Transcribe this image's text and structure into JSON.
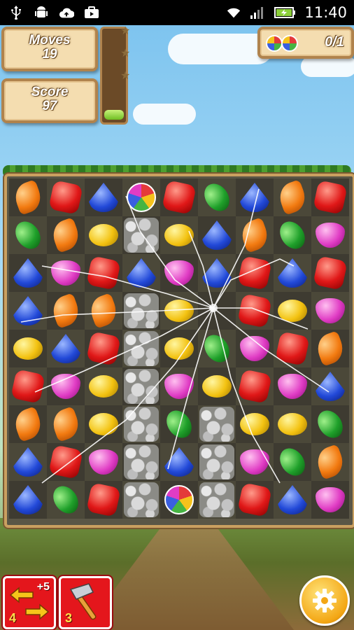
{
  "status_bar": {
    "time": "11:40",
    "left_icons": [
      "usb-icon",
      "android-debug-icon",
      "cloud-upload-icon",
      "briefcase-icon"
    ],
    "right_icons": [
      "wifi-icon",
      "signal-icon",
      "battery-icon"
    ]
  },
  "hud": {
    "moves_label": "Moves",
    "moves_value": "19",
    "score_label": "Score",
    "score_value": "97",
    "goal_value": "0/1",
    "goal_icon": "rainbow-candy-icon",
    "score_progress_fraction": 0.1
  },
  "board": {
    "rows": [
      [
        "orange",
        "red",
        "blue",
        "rainbow",
        "red",
        "green",
        "blue",
        "orange",
        "red"
      ],
      [
        "green",
        "orange",
        "yellow",
        "rock",
        "yellow",
        "blue",
        "orange",
        "green",
        "pink"
      ],
      [
        "blue",
        "pink",
        "red",
        "blue",
        "pink",
        "blue",
        "red",
        "blue",
        "red"
      ],
      [
        "blue",
        "orange",
        "orange",
        "rock",
        "yellow",
        "",
        "red",
        "yellow",
        "pink"
      ],
      [
        "yellow",
        "blue",
        "red",
        "rock",
        "yellow",
        "green",
        "pink",
        "red",
        "orange"
      ],
      [
        "red",
        "pink",
        "yellow",
        "rock",
        "pink",
        "yellow",
        "red",
        "pink",
        "blue"
      ],
      [
        "orange",
        "orange",
        "yellow",
        "rock",
        "green",
        "rock",
        "yellow",
        "yellow",
        "green"
      ],
      [
        "blue",
        "red",
        "pink",
        "rock",
        "blue",
        "rock",
        "pink",
        "green",
        "orange"
      ],
      [
        "blue",
        "green",
        "red",
        "rock",
        "rainbow",
        "rock",
        "red",
        "blue",
        "pink"
      ]
    ]
  },
  "boosters": [
    {
      "name": "extra-moves-booster",
      "icon": "swap-arrows-icon",
      "badge": "+5",
      "count": "4"
    },
    {
      "name": "hammer-booster",
      "icon": "hammer-icon",
      "badge": "",
      "count": "3"
    }
  ],
  "settings_icon": "gear-icon",
  "colors": {
    "board_border": "#caa060",
    "panel_bg": "#f4ddb0",
    "booster_bg": "#e4161c",
    "settings_bg": "#f3a614"
  }
}
